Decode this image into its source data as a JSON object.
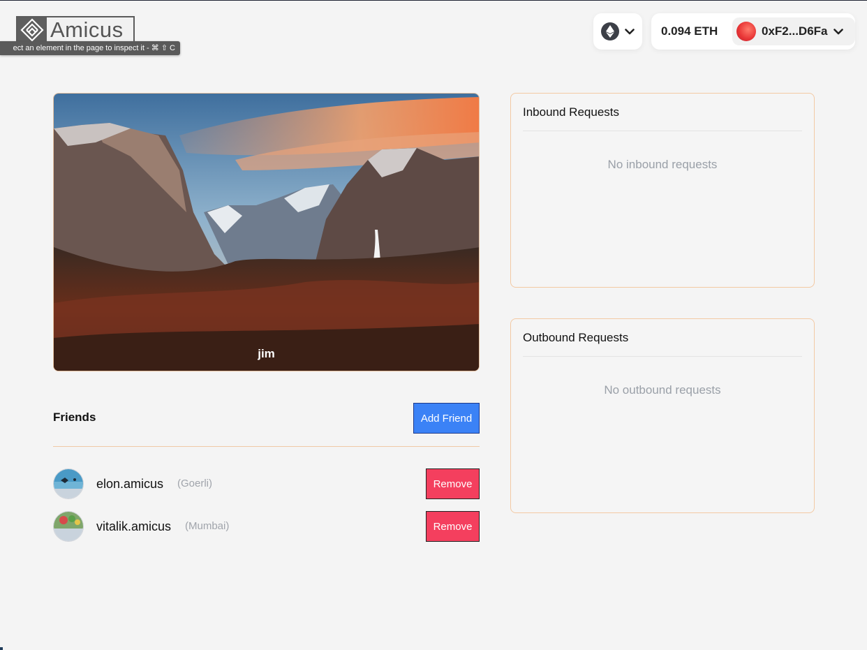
{
  "header": {
    "logo_text": "Amicus",
    "inspect_tooltip": "ect an element in the page to inspect it - ⌘ ⇧ C",
    "chain_icon": "ethereum-icon",
    "balance": "0.094 ETH",
    "address": "0xF2...D6Fa"
  },
  "profile": {
    "name": "jim"
  },
  "friends": {
    "title": "Friends",
    "add_label": "Add Friend",
    "items": [
      {
        "name": "elon.amicus",
        "network": "(Goerli)",
        "remove_label": "Remove"
      },
      {
        "name": "vitalik.amicus",
        "network": "(Mumbai)",
        "remove_label": "Remove"
      }
    ]
  },
  "inbound": {
    "title": "Inbound Requests",
    "empty": "No inbound requests"
  },
  "outbound": {
    "title": "Outbound Requests",
    "empty": "No outbound requests"
  },
  "colors": {
    "accent_blue": "#3b82f6",
    "remove_red": "#f43f5e",
    "panel_border": "#f3c9a3"
  }
}
